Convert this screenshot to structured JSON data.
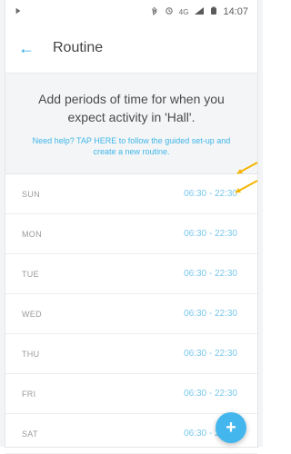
{
  "status_bar": {
    "left_icon": "play-icon",
    "right_icons": [
      "bluetooth-icon",
      "alarm-icon",
      "mobile-data-icon",
      "signal-icon",
      "battery-icon"
    ],
    "network": "4G",
    "time": "14:07"
  },
  "app_bar": {
    "title": "Routine",
    "back_icon": "back-arrow-icon"
  },
  "info": {
    "main_text": "Add periods of time for when you expect activity in 'Hall'.",
    "help_text": "Need help? TAP HERE to follow the guided set-up and create a new routine."
  },
  "days": [
    {
      "day": "SUN",
      "range": "06:30 - 22:30"
    },
    {
      "day": "MON",
      "range": "06:30 - 22:30"
    },
    {
      "day": "TUE",
      "range": "06:30 - 22:30"
    },
    {
      "day": "WED",
      "range": "06:30 - 22:30"
    },
    {
      "day": "THU",
      "range": "06:30 - 22:30"
    },
    {
      "day": "FRI",
      "range": "06:30 - 22:30"
    },
    {
      "day": "SAT",
      "range": "06:30 - 22:30"
    }
  ],
  "fab": {
    "label": "+"
  },
  "colors": {
    "accent": "#2aa8e0",
    "range": "#78c7ec",
    "fab": "#44b6ee",
    "arrow": "#f4b400"
  }
}
